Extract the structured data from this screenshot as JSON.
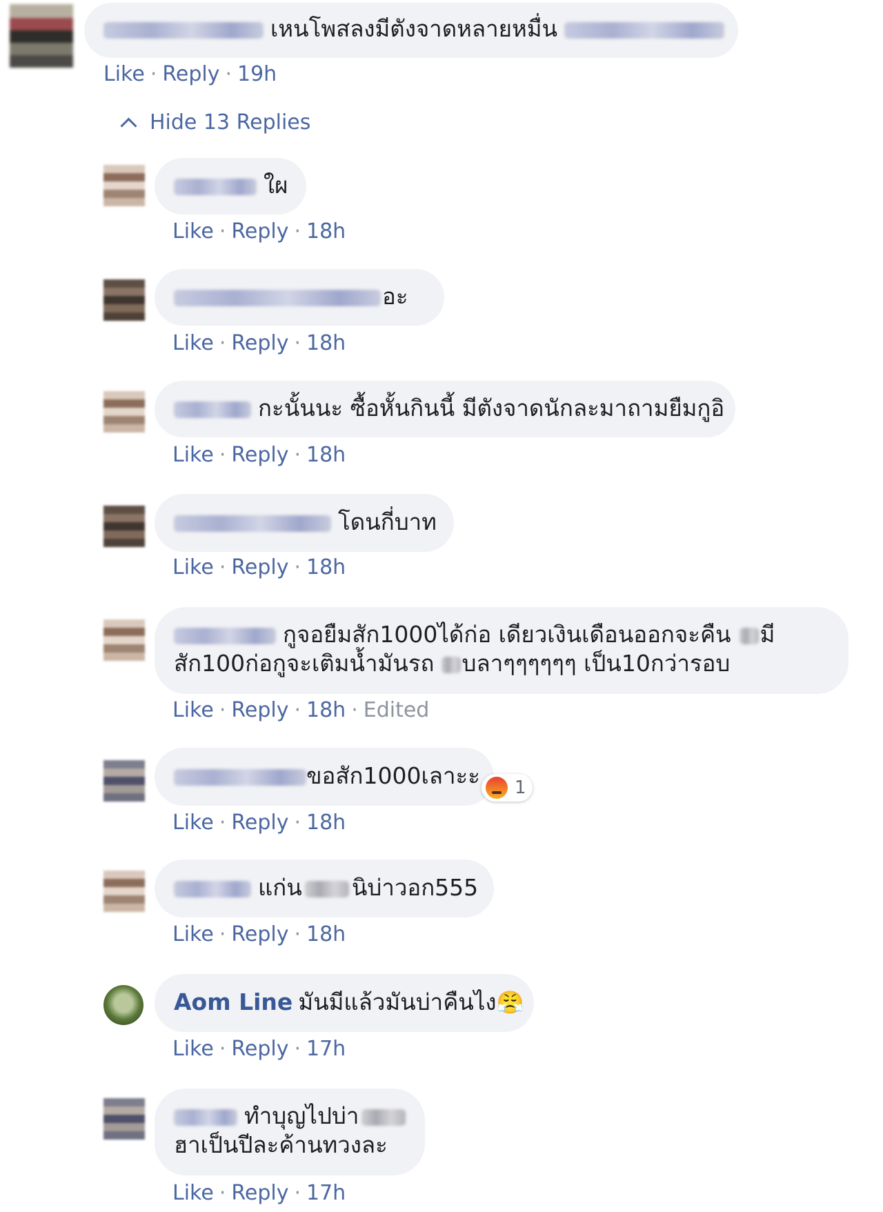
{
  "top_comment": {
    "text": "เหนโพสลงมีตังจาดหลายหมื่น",
    "time": "19h"
  },
  "actions": {
    "like": "Like",
    "reply": "Reply",
    "sep": "·",
    "edited": "Edited"
  },
  "hide_replies": "Hide 13 Replies",
  "replies": [
    {
      "text": "ใผ",
      "time": "18h"
    },
    {
      "text": "อะ",
      "time": "18h"
    },
    {
      "text": "กะนั้นนะ ซื้อหั้นกินนี้ มีตังจาดนักละมาถามยืมกูอิ",
      "time": "18h"
    },
    {
      "text": "โดนกี่บาท",
      "time": "18h"
    },
    {
      "line1a": "กูจอยืมสัก1000ได้ก่อ เดียวเงินเดือนออกจะคืน",
      "line1b": "มี",
      "line2a": "สัก100ก่อกูจะเติมน้ำมันรถ",
      "line2b": "บลาๆๆๆๆๆๆ เป็น10กว่ารอบ",
      "time": "18h"
    },
    {
      "text": "ขอสัก1000เลาะะ",
      "reaction_count": "1",
      "time": "18h"
    },
    {
      "text_a": "แก่น",
      "text_b": "นิบ่าวอก555",
      "time": "18h"
    },
    {
      "author": "Aom Line",
      "text": "มันมีแล้วมันบ่าคืนไง",
      "emoji": "😤",
      "time": "17h"
    },
    {
      "line1": "ทำบุญไปบ่า",
      "line2": "ฮาเป็นปีละค้านทวงละ",
      "time": "17h"
    }
  ],
  "icons": {
    "chevron": "chevron-up-icon",
    "angry_reaction": "angry-reaction-icon"
  },
  "colors": {
    "link": "#4b67a1",
    "bubble": "#f1f2f5",
    "meta": "#8d949e",
    "author": "#385898"
  }
}
